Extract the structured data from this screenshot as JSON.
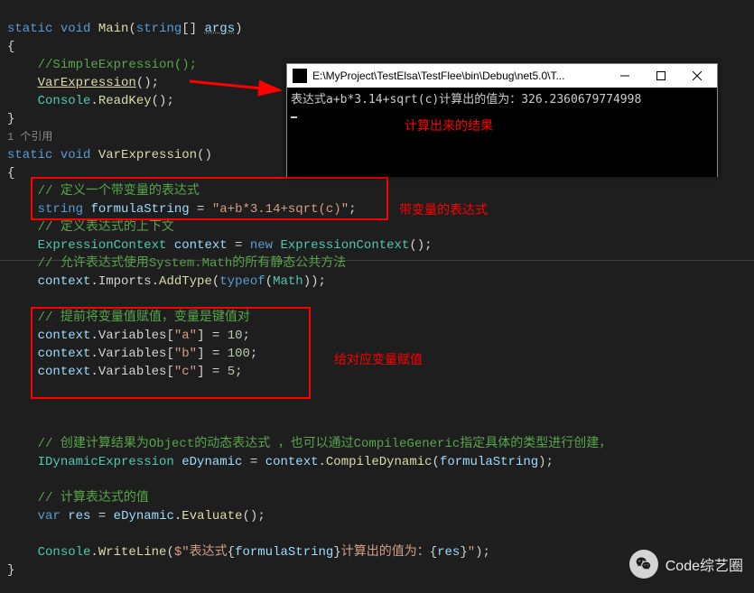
{
  "code": {
    "main_sig": {
      "kw1": "static",
      "kw2": "void",
      "name": "Main",
      "paramType": "string",
      "paramName": "args"
    },
    "c1": "//SimpleExpression();",
    "l_varcall_m": "VarExpression",
    "l_console": "Console",
    "l_readkey": "ReadKey",
    "reflink": "1 个引用",
    "varexp_sig": {
      "kw1": "static",
      "kw2": "void",
      "name": "VarExpression"
    },
    "c2": "// 定义一个带变量的表达式",
    "formula_type": "string",
    "formula_name": "formulaString",
    "formula_val": "\"a+b*3.14+sqrt(c)\"",
    "c3": "// 定义表达式的上下文",
    "ctx_type": "ExpressionContext",
    "ctx_name": "context",
    "ctx_new": "new",
    "ctx_ctor": "ExpressionContext",
    "c4": "// 允许表达式使用System.Math的所有静态公共方法",
    "imp_obj": "context",
    "imp_prop": "Imports",
    "imp_method": "AddType",
    "imp_typeof": "typeof",
    "imp_math": "Math",
    "c5": "// 提前将变量值赋值，变量是键值对",
    "va": {
      "obj": "context",
      "prop": "Variables",
      "key": "\"a\"",
      "val": "10"
    },
    "vb": {
      "obj": "context",
      "prop": "Variables",
      "key": "\"b\"",
      "val": "100"
    },
    "vc": {
      "obj": "context",
      "prop": "Variables",
      "key": "\"c\"",
      "val": "5"
    },
    "c6": "// 创建计算结果为Object的动态表达式 ，也可以通过CompileGeneric指定具体的类型进行创建，",
    "dyn_type": "IDynamicExpression",
    "dyn_name": "eDynamic",
    "dyn_obj": "context",
    "dyn_method": "CompileDynamic",
    "dyn_arg": "formulaString",
    "c7": "// 计算表达式的值",
    "res_kw": "var",
    "res_name": "res",
    "res_obj": "eDynamic",
    "res_method": "Evaluate",
    "wl_obj": "Console",
    "wl_method": "WriteLine",
    "wl_prefix": "$\"表达式",
    "wl_inter1": "formulaString",
    "wl_mid": "计算出的值为：",
    "wl_inter2": "res",
    "wl_suffix": "\""
  },
  "console": {
    "title": "E:\\MyProject\\TestElsa\\TestFlee\\bin\\Debug\\net5.0\\T...",
    "output": "表达式a+b*3.14+sqrt(c)计算出的值为：326.2360679774998"
  },
  "annotations": {
    "result": "计算出来的结果",
    "expr": "带变量的表达式",
    "assign": "给对应变量赋值"
  },
  "watermark": "Code综艺圈"
}
